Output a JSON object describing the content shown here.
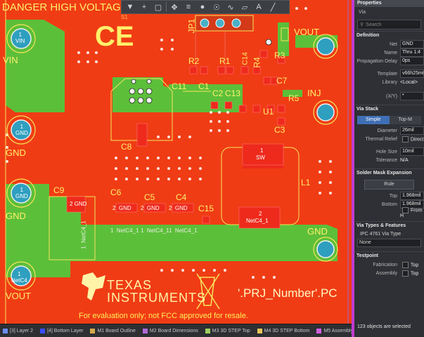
{
  "board": {
    "silk_top": "DANGER HIGH VOLTAG",
    "ce_mark": "CE",
    "j1": "JP1",
    "s1": "S1",
    "ti_name_1": "TEXAS",
    "ti_name_2": "INSTRUMENTS",
    "prj_text": "'.PRJ_Number'.PC",
    "eval_text": "For evaluation only; not FCC approved for resale.",
    "net_labels": {
      "vin": "VIN",
      "gnd1": "GND",
      "gnd2": "GND",
      "gnd3": "GND",
      "vout_left": "VOUT",
      "vout_right": "VOUT",
      "inj": "INJ"
    },
    "designators": {
      "r2": "R2",
      "r1": "R1",
      "c14": "C14",
      "r4": "R4",
      "r3": "R3",
      "c7": "C7",
      "r5": "R5",
      "c11": "C11",
      "c1": "C1",
      "c2": "C2",
      "c13": "C13",
      "u1": "U1",
      "c3": "C3",
      "c8": "C8",
      "l1": "L1",
      "c9": "C9",
      "c6": "C6",
      "c5": "C5",
      "c4": "C4",
      "c15": "C15"
    },
    "pads": {
      "vin_pad": "1\nVIN",
      "gnd_pad1": "1\nGND",
      "gnd_pad2": "1\nGND",
      "vout_pad": "1\nNetC4",
      "c9_pad": "2 GND",
      "c6_pad": "2  GND",
      "c5_pad": "2  GND",
      "c4_pad": "2  GND",
      "netc4_1": "1  NetC4_1",
      "netc4_2": "1  NetC4_1",
      "netc4_3": "1  NetC4_1",
      "l1_pad1_num": "1",
      "l1_pad1_name": "SW",
      "l1_pad2_num": "2",
      "l1_pad2_name": "NetC4_1",
      "c9_net": "1  NetC4_1"
    }
  },
  "toolbar": {
    "icons": [
      "filter-icon",
      "add-icon",
      "select-rect-icon",
      "move-icon",
      "align-icon",
      "place-pad-icon",
      "via-icon",
      "route-icon",
      "polygon-icon",
      "text-icon",
      "line-icon"
    ]
  },
  "layers": [
    {
      "label": "[3] Layer 2",
      "color": "#6a8df0"
    },
    {
      "label": "[4] Bottom Layer",
      "color": "#3a4cff"
    },
    {
      "label": "M1 Board Outline",
      "color": "#d4a94a"
    },
    {
      "label": "M2 Board Dimensions",
      "color": "#b06ad8"
    },
    {
      "label": "M3 3D STEP Top",
      "color": "#9fd15e"
    },
    {
      "label": "M4 3D STEP Bottom",
      "color": "#e8c35a"
    },
    {
      "label": "M5 Assembly Top",
      "color": "#d35fe0"
    },
    {
      "label": "M6 Assembly Bottom",
      "color": "#d66fe8"
    }
  ],
  "panel": {
    "title": "Properties",
    "object_type": "Via",
    "search_placeholder": "Search",
    "sections": {
      "definition": "Definition",
      "via_stack": "Via Stack",
      "solder_mask": "Solder Mask Expansion",
      "via_types": "Via Types & Features",
      "testpoint": "Testpoint"
    },
    "definition": {
      "net_label": "Net",
      "net_value": "GND",
      "name_label": "Name",
      "name_value": "Thru 1:4",
      "prop_delay_label": "Propagation Delay",
      "prop_delay_value": "0ps",
      "template_label": "Template",
      "template_value": "v66h25m0",
      "library_label": "Library",
      "library_value": "<Local>",
      "xy_label": "(X/Y)",
      "xy_value": "*"
    },
    "via_stack": {
      "simple": "Simple",
      "top_mid": "Top-M",
      "diameter_label": "Diameter",
      "diameter_value": "26mil",
      "thermal_label": "Thermal Relief",
      "direct_label": "Direct",
      "hole_label": "Hole Size",
      "hole_value": "10mil",
      "tolerance_label": "Tolerance",
      "tolerance_value": "N/A"
    },
    "solder_mask": {
      "rule_button": "Rule",
      "top_label": "Top",
      "top_value": "1.968mil",
      "bottom_label": "Bottom",
      "bottom_value": "1.968mil",
      "from_hole_label": "From H"
    },
    "via_types": {
      "ipc_label": "IPC 4761 Via Type",
      "ipc_value": "None"
    },
    "testpoint": {
      "fabrication_label": "Fabrication",
      "fab_top": "Top",
      "assembly_label": "Assembly",
      "asm_top": "Top"
    },
    "status": "123 objects are selected"
  }
}
